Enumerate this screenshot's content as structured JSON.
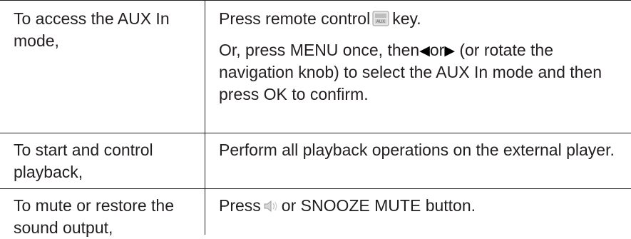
{
  "rows": [
    {
      "action": "To access the AUX In mode,",
      "instr_a_before": "Press remote control",
      "instr_a_icon": "aux-key-icon",
      "instr_a_after": "key.",
      "instr_b_1": "Or, press MENU once, then",
      "instr_b_left_arrow": "◀",
      "instr_b_or": "or",
      "instr_b_right_arrow": "▶",
      "instr_b_2": "(or rotate the navigation knob) to select the AUX In mode and then press OK to confirm."
    },
    {
      "action": "To start and control playback,",
      "instr": "Perform all playback operations on the external player."
    },
    {
      "action": "To mute or restore the sound output,",
      "instr_before": "Press",
      "instr_icon": "mute-icon",
      "instr_after": "or SNOOZE MUTE button."
    }
  ]
}
